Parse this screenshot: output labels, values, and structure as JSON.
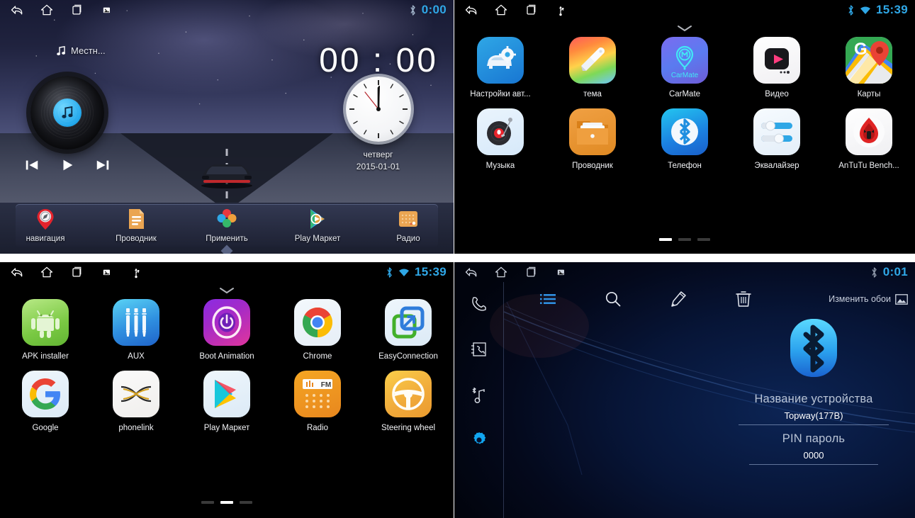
{
  "panels": {
    "home": {
      "name": "car-home-screen",
      "statusbar": {
        "nav": [
          "back-icon",
          "home-icon",
          "recents-icon",
          "screenshot-icon"
        ],
        "bluetooth_icon": "bluetooth-icon",
        "clock": "0:00"
      },
      "music_source": "Местн...",
      "big_clock": "00 : 00",
      "day": "четверг",
      "date": "2015-01-01",
      "transport": [
        "prev-track-button",
        "play-button",
        "next-track-button"
      ],
      "dock": [
        {
          "label": "навигация",
          "icon": "navigation-pin-icon"
        },
        {
          "label": "Проводник",
          "icon": "file-manager-icon"
        },
        {
          "label": "Применить",
          "icon": "apply-petals-icon"
        },
        {
          "label": "Play Маркет",
          "icon": "play-store-icon"
        },
        {
          "label": "Радио",
          "icon": "radio-icon"
        }
      ]
    },
    "drawer1": {
      "name": "app-drawer-page-1",
      "statusbar": {
        "nav": [
          "back-icon",
          "home-icon",
          "recents-icon",
          "usb-icon"
        ],
        "bluetooth_icon": "bluetooth-icon",
        "wifi_icon": "wifi-icon",
        "clock": "15:39"
      },
      "apps": [
        {
          "label": "Настройки авт...",
          "icon": "car-settings-icon"
        },
        {
          "label": "тема",
          "icon": "theme-brush-icon"
        },
        {
          "label": "CarMate",
          "icon": "carmate-icon"
        },
        {
          "label": "Видео",
          "icon": "video-player-icon"
        },
        {
          "label": "Карты",
          "icon": "google-maps-icon"
        },
        {
          "label": "Музыка",
          "icon": "music-turntable-icon"
        },
        {
          "label": "Проводник",
          "icon": "file-manager-icon"
        },
        {
          "label": "Телефон",
          "icon": "bluetooth-phone-icon"
        },
        {
          "label": "Эквалайзер",
          "icon": "equalizer-icon"
        },
        {
          "label": "AnTuTu Bench...",
          "icon": "antutu-icon"
        }
      ],
      "pages": 3,
      "active_page": 1
    },
    "drawer2": {
      "name": "app-drawer-page-2",
      "statusbar": {
        "nav": [
          "back-icon",
          "home-icon",
          "recents-icon",
          "screenshot-icon",
          "usb-icon"
        ],
        "bluetooth_icon": "bluetooth-icon",
        "wifi_icon": "wifi-icon",
        "clock": "15:39"
      },
      "apps": [
        {
          "label": "APK installer",
          "icon": "android-robot-icon"
        },
        {
          "label": "AUX",
          "icon": "aux-jack-icon"
        },
        {
          "label": "Boot Animation",
          "icon": "power-ring-icon"
        },
        {
          "label": "Chrome",
          "icon": "chrome-icon"
        },
        {
          "label": "EasyConnection",
          "icon": "easyconnection-icon"
        },
        {
          "label": "Google",
          "icon": "google-g-icon"
        },
        {
          "label": "phonelink",
          "icon": "phonelink-icon"
        },
        {
          "label": "Play Маркет",
          "icon": "play-store-icon"
        },
        {
          "label": "Radio",
          "icon": "fm-radio-icon"
        },
        {
          "label": "Steering wheel",
          "icon": "steering-wheel-icon"
        }
      ],
      "pages": 3,
      "active_page": 2
    },
    "bluetooth": {
      "name": "bluetooth-settings-screen",
      "statusbar": {
        "nav": [
          "back-icon",
          "home-icon",
          "recents-icon",
          "screenshot-icon"
        ],
        "bluetooth_icon": "bluetooth-icon",
        "clock": "0:01"
      },
      "sidebar": [
        {
          "icon": "dialpad-phone-icon",
          "active": false
        },
        {
          "icon": "contacts-book-icon",
          "active": false
        },
        {
          "icon": "bluetooth-music-icon",
          "active": false
        },
        {
          "icon": "settings-gear-icon",
          "active": true
        }
      ],
      "toolbar": [
        {
          "icon": "list-icon",
          "active": true
        },
        {
          "icon": "search-icon",
          "active": false
        },
        {
          "icon": "edit-pen-icon",
          "active": false
        },
        {
          "icon": "trash-icon",
          "active": false
        }
      ],
      "wallpaper_button": {
        "label": "Изменить обои",
        "icon": "image-icon"
      },
      "device": {
        "logo": "bluetooth-logo-icon",
        "name_label": "Название устройства",
        "name_value": "Topway(177B)",
        "pin_label": "PIN пароль",
        "pin_value": "0000"
      }
    }
  },
  "colors": {
    "accent_blue": "#2fa7e6",
    "bt_blue": "#29a9f0",
    "text_primary": "#ffffff",
    "text_muted": "#b9c4d6"
  }
}
